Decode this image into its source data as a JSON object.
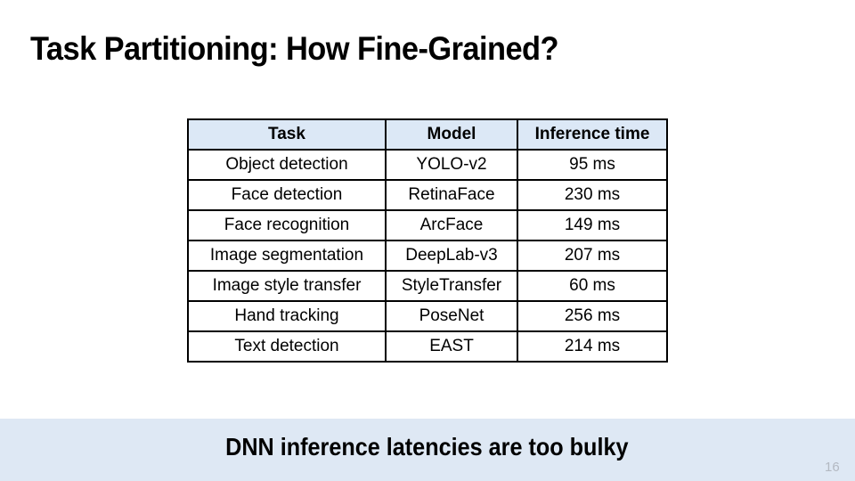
{
  "slide": {
    "title": "Task Partitioning: How Fine-Grained?",
    "slide_number": "16"
  },
  "table": {
    "headers": [
      "Task",
      "Model",
      "Inference time"
    ],
    "rows": [
      [
        "Object detection",
        "YOLO-v2",
        "95 ms"
      ],
      [
        "Face detection",
        "RetinaFace",
        "230 ms"
      ],
      [
        "Face recognition",
        "ArcFace",
        "149 ms"
      ],
      [
        "Image segmentation",
        "DeepLab-v3",
        "207 ms"
      ],
      [
        "Image style transfer",
        "StyleTransfer",
        "60 ms"
      ],
      [
        "Hand tracking",
        "PoseNet",
        "256 ms"
      ],
      [
        "Text detection",
        "EAST",
        "214 ms"
      ]
    ]
  },
  "banner": {
    "text": "DNN inference latencies are too bulky"
  },
  "colors": {
    "header_fill": "#dce8f6",
    "banner_fill": "#dee8f4"
  }
}
